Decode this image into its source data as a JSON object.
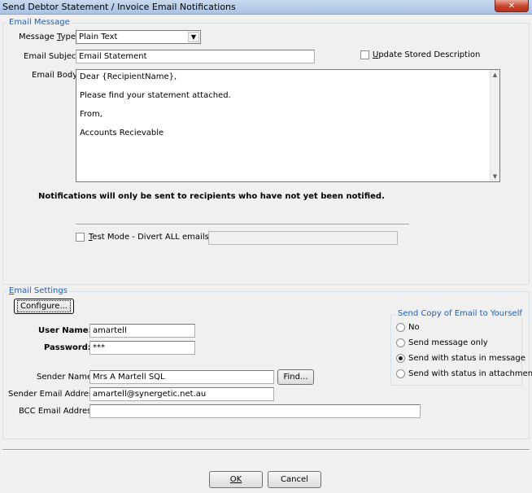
{
  "window": {
    "title": "Send Debtor Statement / Invoice Email Notifications",
    "close_glyph": "✕"
  },
  "email_message": {
    "group_title": "Email Message",
    "message_type_label": "Message Type:",
    "message_type_value": "Plain Text",
    "email_subject_label": "Email Subject:",
    "email_subject_value": "Email Statement",
    "update_stored_description_label": "Update Stored Description",
    "update_stored_description_checked": false,
    "email_body_label": "Email Body:",
    "email_body_lines": [
      "Dear {RecipientName},",
      "Please find your statement attached.",
      "From,",
      "Accounts Recievable"
    ],
    "notice": "Notifications will only be sent to recipients who have not yet been notified.",
    "test_mode_label": "Test Mode - Divert ALL emails to:",
    "test_mode_checked": false,
    "test_mode_email_value": ""
  },
  "email_settings": {
    "group_title": "Email Settings",
    "configure_button": "Configure...",
    "user_name_label": "User Name:",
    "user_name_value": "amartell",
    "password_label": "Password:",
    "password_value": "***",
    "sender_name_label": "Sender Name:",
    "sender_name_value": "Mrs A Martell SQL",
    "find_button": "Find...",
    "sender_email_label": "Sender Email Address:",
    "sender_email_value": "amartell@synergetic.net.au",
    "bcc_email_label": "BCC Email Address:",
    "bcc_email_value": ""
  },
  "send_copy": {
    "group_title": "Send Copy of Email to Yourself",
    "options": [
      {
        "label": "No",
        "checked": false
      },
      {
        "label": "Send message only",
        "checked": false
      },
      {
        "label": "Send with status in message",
        "checked": true
      },
      {
        "label": "Send with status in attachment",
        "checked": false
      }
    ]
  },
  "footer": {
    "ok_button": "OK",
    "cancel_button": "Cancel"
  },
  "colors": {
    "group_title": "#1c5fbd",
    "titlebar": "#b5cbe8",
    "close_button": "#c7432b"
  }
}
